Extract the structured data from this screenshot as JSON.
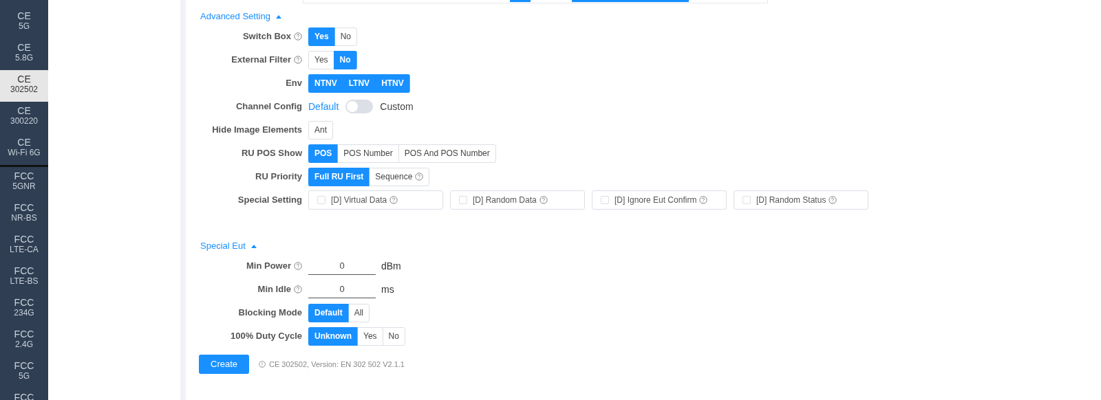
{
  "sidebar": {
    "groups": [
      {
        "items": [
          {
            "title": "CE",
            "subtitle": "5G",
            "selected": false
          },
          {
            "title": "CE",
            "subtitle": "5.8G",
            "selected": false
          },
          {
            "title": "CE",
            "subtitle": "302502",
            "selected": true
          },
          {
            "title": "CE",
            "subtitle": "300220",
            "selected": false
          },
          {
            "title": "CE",
            "subtitle": "Wi-Fi 6G",
            "selected": false
          }
        ]
      },
      {
        "items": [
          {
            "title": "FCC",
            "subtitle": "5GNR",
            "selected": false
          },
          {
            "title": "FCC",
            "subtitle": "NR-BS",
            "selected": false
          },
          {
            "title": "FCC",
            "subtitle": "LTE-CA",
            "selected": false
          },
          {
            "title": "FCC",
            "subtitle": "LTE-BS",
            "selected": false
          },
          {
            "title": "FCC",
            "subtitle": "234G",
            "selected": false
          },
          {
            "title": "FCC",
            "subtitle": "2.4G",
            "selected": false
          },
          {
            "title": "FCC",
            "subtitle": "5G",
            "selected": false
          },
          {
            "title": "FCC",
            "selected": false
          }
        ]
      }
    ]
  },
  "sections": [
    {
      "title": "Advanced Setting",
      "expanded": true,
      "fields": [
        {
          "kind": "segmented",
          "label": "Switch Box",
          "help": true,
          "options": [
            {
              "label": "Yes",
              "selected": true
            },
            {
              "label": "No",
              "selected": false
            }
          ]
        },
        {
          "kind": "segmented",
          "label": "External Filter",
          "help": true,
          "options": [
            {
              "label": "Yes",
              "selected": false
            },
            {
              "label": "No",
              "selected": true
            }
          ]
        },
        {
          "kind": "segmented",
          "label": "Env",
          "help": false,
          "options": [
            {
              "label": "NTNV",
              "selected": true
            },
            {
              "label": "LTNV",
              "selected": true
            },
            {
              "label": "HTNV",
              "selected": true
            }
          ]
        },
        {
          "kind": "switch",
          "label": "Channel Config",
          "help": false,
          "left": "Default",
          "right": "Custom",
          "on": false
        },
        {
          "kind": "segmented",
          "label": "Hide Image Elements",
          "help": false,
          "options": [
            {
              "label": "Ant",
              "selected": false
            }
          ]
        },
        {
          "kind": "segmented",
          "label": "RU POS Show",
          "help": false,
          "options": [
            {
              "label": "POS",
              "selected": true
            },
            {
              "label": "POS Number",
              "selected": false
            },
            {
              "label": "POS And POS Number",
              "selected": false
            }
          ]
        },
        {
          "kind": "segmented",
          "label": "RU Priority",
          "help": false,
          "options": [
            {
              "label": "Full RU First",
              "selected": true
            },
            {
              "label": "Sequence",
              "selected": false,
              "help": true
            }
          ]
        },
        {
          "kind": "checkboxes",
          "label": "Special Setting",
          "help": false,
          "options": [
            {
              "label": "[D] Virtual Data",
              "checked": false,
              "help": true
            },
            {
              "label": "[D] Random Data",
              "checked": false,
              "help": true
            },
            {
              "label": "[D] Ignore Eut Confirm",
              "checked": false,
              "help": true
            },
            {
              "label": "[D] Random Status",
              "checked": false,
              "help": true
            }
          ]
        }
      ]
    },
    {
      "title": "Special Eut",
      "expanded": true,
      "fields": [
        {
          "kind": "input",
          "label": "Min Power",
          "help": true,
          "value": "0",
          "unit": "dBm"
        },
        {
          "kind": "input",
          "label": "Min Idle",
          "help": true,
          "value": "0",
          "unit": "ms"
        },
        {
          "kind": "segmented",
          "label": "Blocking Mode",
          "help": false,
          "options": [
            {
              "label": "Default",
              "selected": true
            },
            {
              "label": "All",
              "selected": false
            }
          ]
        },
        {
          "kind": "segmented",
          "label": "100% Duty Cycle",
          "help": false,
          "options": [
            {
              "label": "Unknown",
              "selected": true
            },
            {
              "label": "Yes",
              "selected": false
            },
            {
              "label": "No",
              "selected": false
            }
          ]
        }
      ]
    }
  ],
  "footer": {
    "button": "Create",
    "note": "CE 302502, Version: EN 302 502 V2.1.1"
  }
}
